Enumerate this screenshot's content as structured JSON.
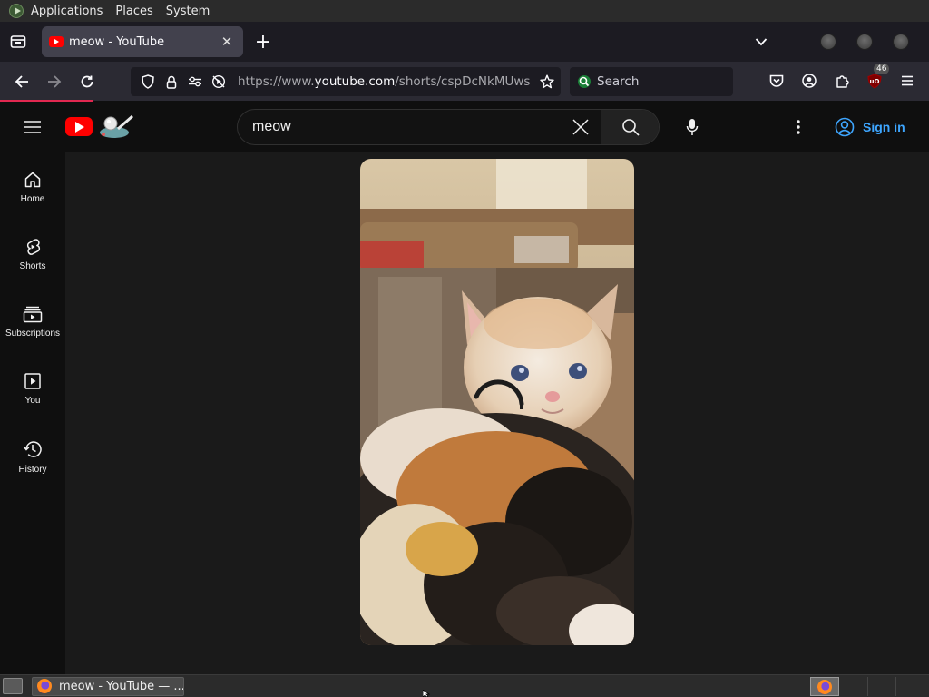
{
  "top_panel": {
    "menus": [
      "Applications",
      "Places",
      "System"
    ]
  },
  "browser": {
    "tab": {
      "title": "meow - YouTube",
      "close_glyph": "✕"
    },
    "new_tab_glyph": "+",
    "url": {
      "prefix": "https://www.",
      "host": "youtube.com",
      "path": "/shorts/cspDcNkMUws"
    },
    "search_placeholder": "Search",
    "extensions_badge": "46",
    "accent_color": "#e22850"
  },
  "youtube": {
    "search_query": "meow",
    "sign_in_label": "Sign in",
    "sidebar": [
      {
        "id": "home",
        "label": "Home",
        "icon": "home-icon"
      },
      {
        "id": "shorts",
        "label": "Shorts",
        "icon": "shorts-icon"
      },
      {
        "id": "subscriptions",
        "label": "Subscriptions",
        "icon": "subscriptions-icon"
      },
      {
        "id": "you",
        "label": "You",
        "icon": "you-icon"
      },
      {
        "id": "history",
        "label": "History",
        "icon": "history-icon"
      }
    ],
    "brand_color": "#ff0000",
    "link_color": "#3ea6ff"
  },
  "taskbar": {
    "window_title": "meow - YouTube — ..."
  }
}
